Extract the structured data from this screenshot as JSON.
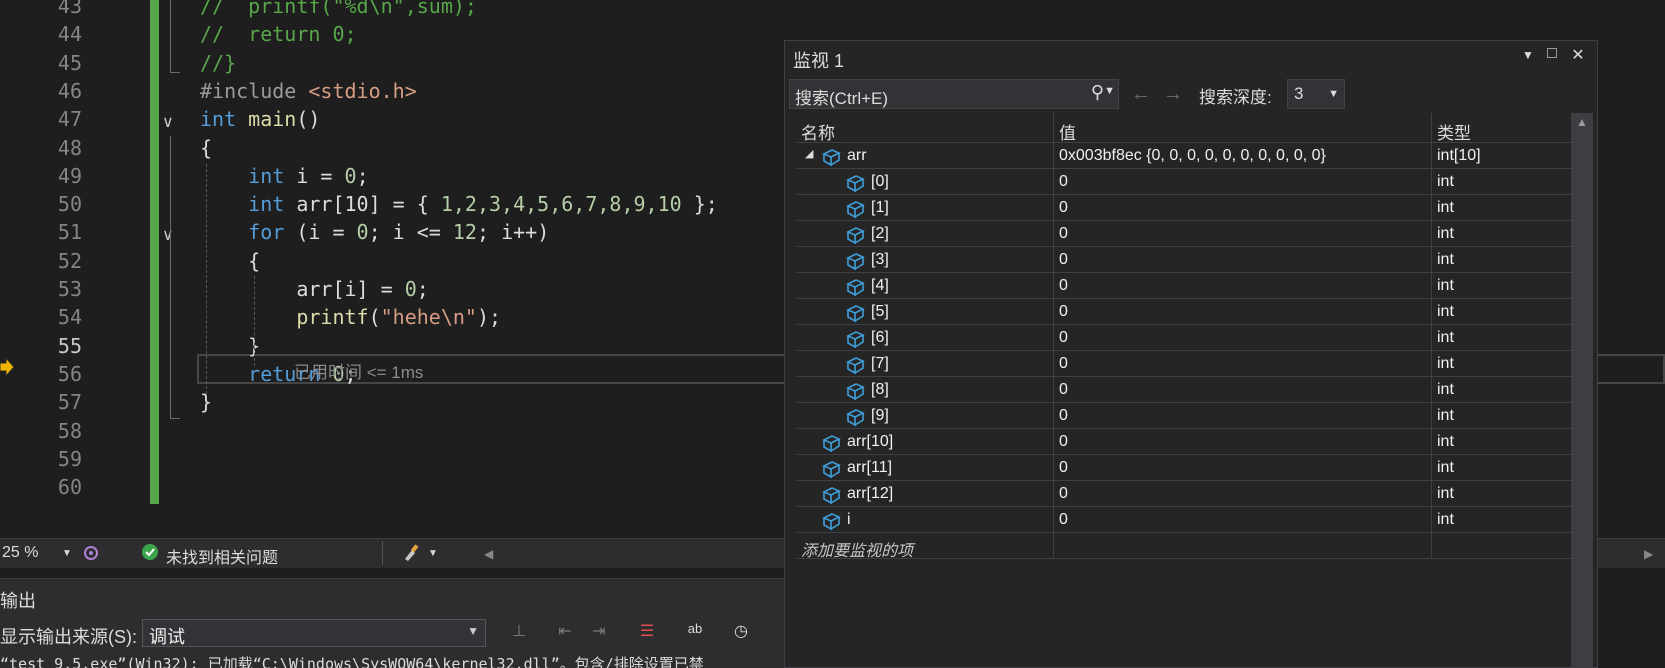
{
  "editor": {
    "lines": [
      {
        "num": "43",
        "code": [
          {
            "t": "//  printf(\"%d\\n\",sum);",
            "c": "cmt"
          }
        ]
      },
      {
        "num": "44",
        "code": [
          {
            "t": "//  return 0;",
            "c": "cmt"
          }
        ]
      },
      {
        "num": "45",
        "code": [
          {
            "t": "//}",
            "c": "cmt"
          }
        ]
      },
      {
        "num": "46",
        "code": [
          {
            "t": "#include ",
            "c": "pp"
          },
          {
            "t": "<stdio.h>",
            "c": "str"
          }
        ]
      },
      {
        "num": "47",
        "code": [
          {
            "t": "int",
            "c": "kw"
          },
          {
            "t": " "
          },
          {
            "t": "main",
            "c": "fn"
          },
          {
            "t": "()"
          }
        ]
      },
      {
        "num": "48",
        "code": [
          {
            "t": "{"
          }
        ]
      },
      {
        "num": "49",
        "code": [
          {
            "t": "    "
          },
          {
            "t": "int",
            "c": "kw"
          },
          {
            "t": " i = "
          },
          {
            "t": "0",
            "c": "num"
          },
          {
            "t": ";"
          }
        ]
      },
      {
        "num": "50",
        "code": [
          {
            "t": "    "
          },
          {
            "t": "int",
            "c": "kw"
          },
          {
            "t": " arr[10] = { "
          },
          {
            "t": "1,2,3,4,5,6,7,8,9,10",
            "c": "num"
          },
          {
            "t": " };"
          }
        ]
      },
      {
        "num": "51",
        "code": [
          {
            "t": "    "
          },
          {
            "t": "for",
            "c": "kw"
          },
          {
            "t": " (i = "
          },
          {
            "t": "0",
            "c": "num"
          },
          {
            "t": "; i <= "
          },
          {
            "t": "12",
            "c": "num"
          },
          {
            "t": "; i++)"
          }
        ]
      },
      {
        "num": "52",
        "code": [
          {
            "t": "    {"
          }
        ]
      },
      {
        "num": "53",
        "code": [
          {
            "t": "        arr[i] = "
          },
          {
            "t": "0",
            "c": "num"
          },
          {
            "t": ";"
          }
        ]
      },
      {
        "num": "54",
        "code": [
          {
            "t": "        "
          },
          {
            "t": "printf",
            "c": "fn"
          },
          {
            "t": "("
          },
          {
            "t": "\"hehe\\n\"",
            "c": "str"
          },
          {
            "t": ");"
          }
        ]
      },
      {
        "num": "55",
        "code": [
          {
            "t": "    }"
          }
        ]
      },
      {
        "num": "56",
        "code": [
          {
            "t": "    "
          },
          {
            "t": "return",
            "c": "kw"
          },
          {
            "t": " "
          },
          {
            "t": "0",
            "c": "num"
          },
          {
            "t": ";"
          }
        ]
      },
      {
        "num": "57",
        "code": [
          {
            "t": "}"
          }
        ]
      },
      {
        "num": "58",
        "code": []
      },
      {
        "num": "59",
        "code": []
      },
      {
        "num": "60",
        "code": []
      }
    ],
    "current_line": "55",
    "perf_tip": "已用时间 <= 1ms"
  },
  "statusbar": {
    "zoom": "25 %",
    "issues": "未找到相关问题"
  },
  "output": {
    "title": "输出",
    "source_label": "显示输出来源(S):",
    "source_value": "调试",
    "text": "“test_9.5.exe”(Win32): 已加载“C:\\Windows\\SysWOW64\\kernel32.dll”。包含/排除设置已禁"
  },
  "watch": {
    "title": "监视 1",
    "search_placeholder": "搜索(Ctrl+E)",
    "depth_label": "搜索深度:",
    "depth_value": "3",
    "columns": {
      "name": "名称",
      "value": "值",
      "type": "类型"
    },
    "rows": [
      {
        "name": "arr",
        "value": "0x003bf8ec {0, 0, 0, 0, 0, 0, 0, 0, 0, 0}",
        "type": "int[10]",
        "level": 0,
        "expanded": true
      },
      {
        "name": "[0]",
        "value": "0",
        "type": "int",
        "level": 1
      },
      {
        "name": "[1]",
        "value": "0",
        "type": "int",
        "level": 1
      },
      {
        "name": "[2]",
        "value": "0",
        "type": "int",
        "level": 1
      },
      {
        "name": "[3]",
        "value": "0",
        "type": "int",
        "level": 1
      },
      {
        "name": "[4]",
        "value": "0",
        "type": "int",
        "level": 1
      },
      {
        "name": "[5]",
        "value": "0",
        "type": "int",
        "level": 1
      },
      {
        "name": "[6]",
        "value": "0",
        "type": "int",
        "level": 1
      },
      {
        "name": "[7]",
        "value": "0",
        "type": "int",
        "level": 1
      },
      {
        "name": "[8]",
        "value": "0",
        "type": "int",
        "level": 1
      },
      {
        "name": "[9]",
        "value": "0",
        "type": "int",
        "level": 1
      },
      {
        "name": "arr[10]",
        "value": "0",
        "type": "int",
        "level": 0
      },
      {
        "name": "arr[11]",
        "value": "0",
        "type": "int",
        "level": 0
      },
      {
        "name": "arr[12]",
        "value": "0",
        "type": "int",
        "level": 0
      },
      {
        "name": "i",
        "value": "0",
        "type": "int",
        "level": 0
      }
    ],
    "add_item": "添加要监视的项"
  },
  "colors": {
    "background": "#1e1e1e",
    "change_bar": "#57a64a",
    "cube_icon": "#3f9fd8"
  }
}
